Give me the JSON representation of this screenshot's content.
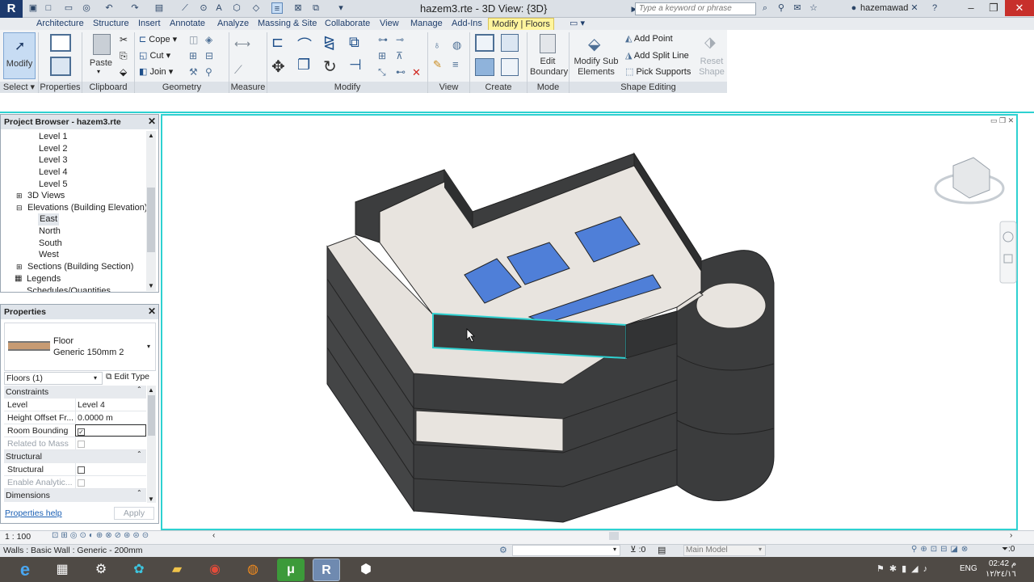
{
  "window": {
    "title": "hazem3.rte - 3D View: {3D}",
    "search_placeholder": "Type a keyword or phrase",
    "user": "hazemawad"
  },
  "tabs": [
    "Architecture",
    "Structure",
    "Insert",
    "Annotate",
    "Analyze",
    "Massing & Site",
    "Collaborate",
    "View",
    "Manage",
    "Add-Ins",
    "Modify | Floors"
  ],
  "ribbon": {
    "modify": "Modify",
    "select": "Select",
    "properties": "Properties",
    "paste": "Paste",
    "clipboard": "Clipboard",
    "cope": "Cope",
    "cut": "Cut",
    "join": "Join",
    "geometry": "Geometry",
    "measure": "Measure",
    "modify_panel": "Modify",
    "view": "View",
    "create": "Create",
    "edit_boundary": "Edit Boundary",
    "mode": "Mode",
    "modify_sub_elements": "Modify Sub Elements",
    "add_point": "Add Point",
    "add_split_line": "Add Split Line",
    "pick_supports": "Pick Supports",
    "reset_shape": "Reset Shape",
    "shape_editing": "Shape Editing"
  },
  "project_browser": {
    "title": "Project Browser - hazem3.rte",
    "items": [
      "Level 1",
      "Level 2",
      "Level 3",
      "Level 4",
      "Level 5",
      "3D Views",
      "Elevations (Building Elevation)",
      "East",
      "North",
      "South",
      "West",
      "Sections (Building Section)",
      "Legends",
      "Schedules/Quantities"
    ]
  },
  "properties": {
    "title": "Properties",
    "family": "Floor",
    "type": "Generic 150mm 2",
    "selector": "Floors (1)",
    "edit_type": "Edit Type",
    "group_constraints": "Constraints",
    "level_key": "Level",
    "level_val": "Level 4",
    "offset_key": "Height Offset Fr...",
    "offset_val": "0.0000 m",
    "room_bounding": "Room Bounding",
    "related_to_mass": "Related to Mass",
    "group_structural": "Structural",
    "structural": "Structural",
    "enable_analytic": "Enable Analytic...",
    "group_dimensions": "Dimensions",
    "help": "Properties help",
    "apply": "Apply"
  },
  "view_control": {
    "scale": "1 : 100"
  },
  "status": {
    "text": "Walls : Basic Wall : Generic - 200mm",
    "count": ":0",
    "model": "Main Model"
  },
  "tray": {
    "lang": "ENG",
    "time": "02:42 م",
    "date": "١٢/٢٤/١٦"
  },
  "colors": {
    "accent": "#2ed1d1",
    "contextual_tab": "#fff59d",
    "wall": "#3c3d3e",
    "floor": "#e8e4df",
    "glass": "#4f7fd8"
  }
}
